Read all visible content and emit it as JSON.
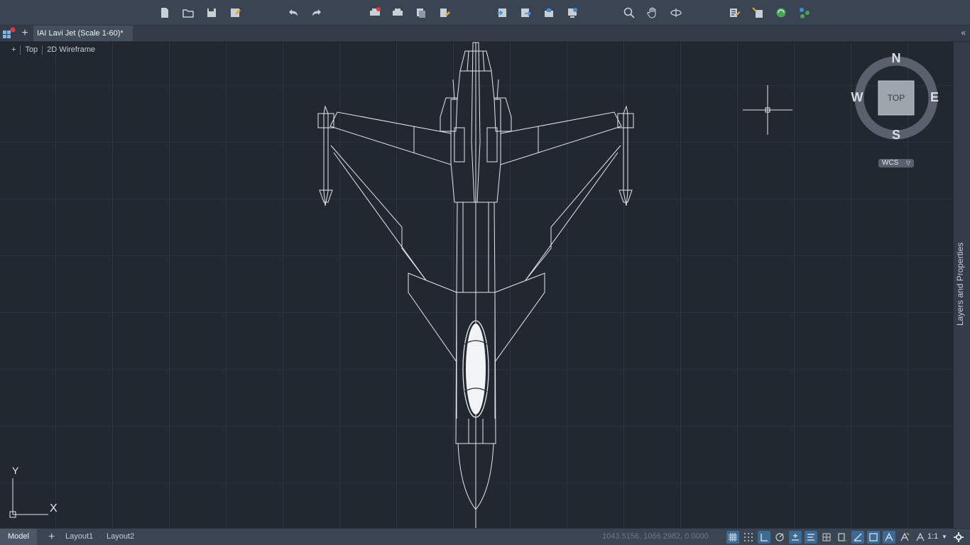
{
  "toolbar": {
    "buttons": [
      "new-icon",
      "open-icon",
      "save-icon",
      "save-as-icon",
      "undo-icon",
      "redo-icon",
      "plot-icon",
      "print-icon",
      "publish-icon",
      "batch-plot-icon",
      "import-icon",
      "export-icon",
      "share-icon",
      "sheet-set-icon",
      "zoom-icon",
      "pan-icon",
      "orbit-icon",
      "properties-icon",
      "match-properties-icon",
      "render-icon",
      "layer-states-icon"
    ]
  },
  "tabs": {
    "document_title": "IAI Lavi Jet (Scale 1-60)*",
    "new_tab": "+"
  },
  "viewport": {
    "controls": [
      "+",
      "Top",
      "2D Wireframe"
    ],
    "viewcube": {
      "face": "TOP",
      "north": "N",
      "south": "S",
      "east": "E",
      "west": "W",
      "ucs": "WCS"
    },
    "ucs_icon": {
      "x": "X",
      "y": "Y"
    }
  },
  "palette": {
    "label": "Layers and Properties"
  },
  "statusbar": {
    "model": "Model",
    "add": "+",
    "layout1": "Layout1",
    "layout2": "Layout2",
    "coordinates": "1043.5156, 1066.2982, 0.0000",
    "scale": "1:1"
  },
  "colors": {
    "background": "#212830",
    "toolbar": "#3b4453",
    "accent": "#3d6a94",
    "drawing_lines": "#e6e9ec"
  }
}
